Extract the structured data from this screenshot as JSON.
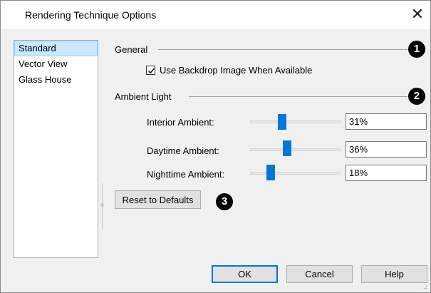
{
  "window": {
    "title": "Rendering Technique Options",
    "close_glyph": "✕"
  },
  "techniques": {
    "items": [
      {
        "label": "Standard",
        "selected": true
      },
      {
        "label": "Vector View",
        "selected": false
      },
      {
        "label": "Glass House",
        "selected": false
      }
    ]
  },
  "general": {
    "label": "General",
    "marker": "1",
    "backdrop_checkbox": {
      "label": "Use Backdrop Image When Available",
      "checked": true
    }
  },
  "ambient": {
    "label": "Ambient Light",
    "marker": "2",
    "rows": [
      {
        "label": "Interior Ambient:",
        "value": "31%",
        "level": 0.31
      },
      {
        "label": "Daytime Ambient:",
        "value": "36%",
        "level": 0.36
      },
      {
        "label": "Nighttime Ambient:",
        "value": "18%",
        "level": 0.18
      }
    ]
  },
  "reset": {
    "label": "Reset to Defaults",
    "marker": "3"
  },
  "footer": {
    "ok_label": "OK",
    "cancel_label": "Cancel",
    "help_label": "Help"
  },
  "colors": {
    "accent": "#0078d7",
    "selection": "#cce8ff",
    "marker": "#000000"
  }
}
